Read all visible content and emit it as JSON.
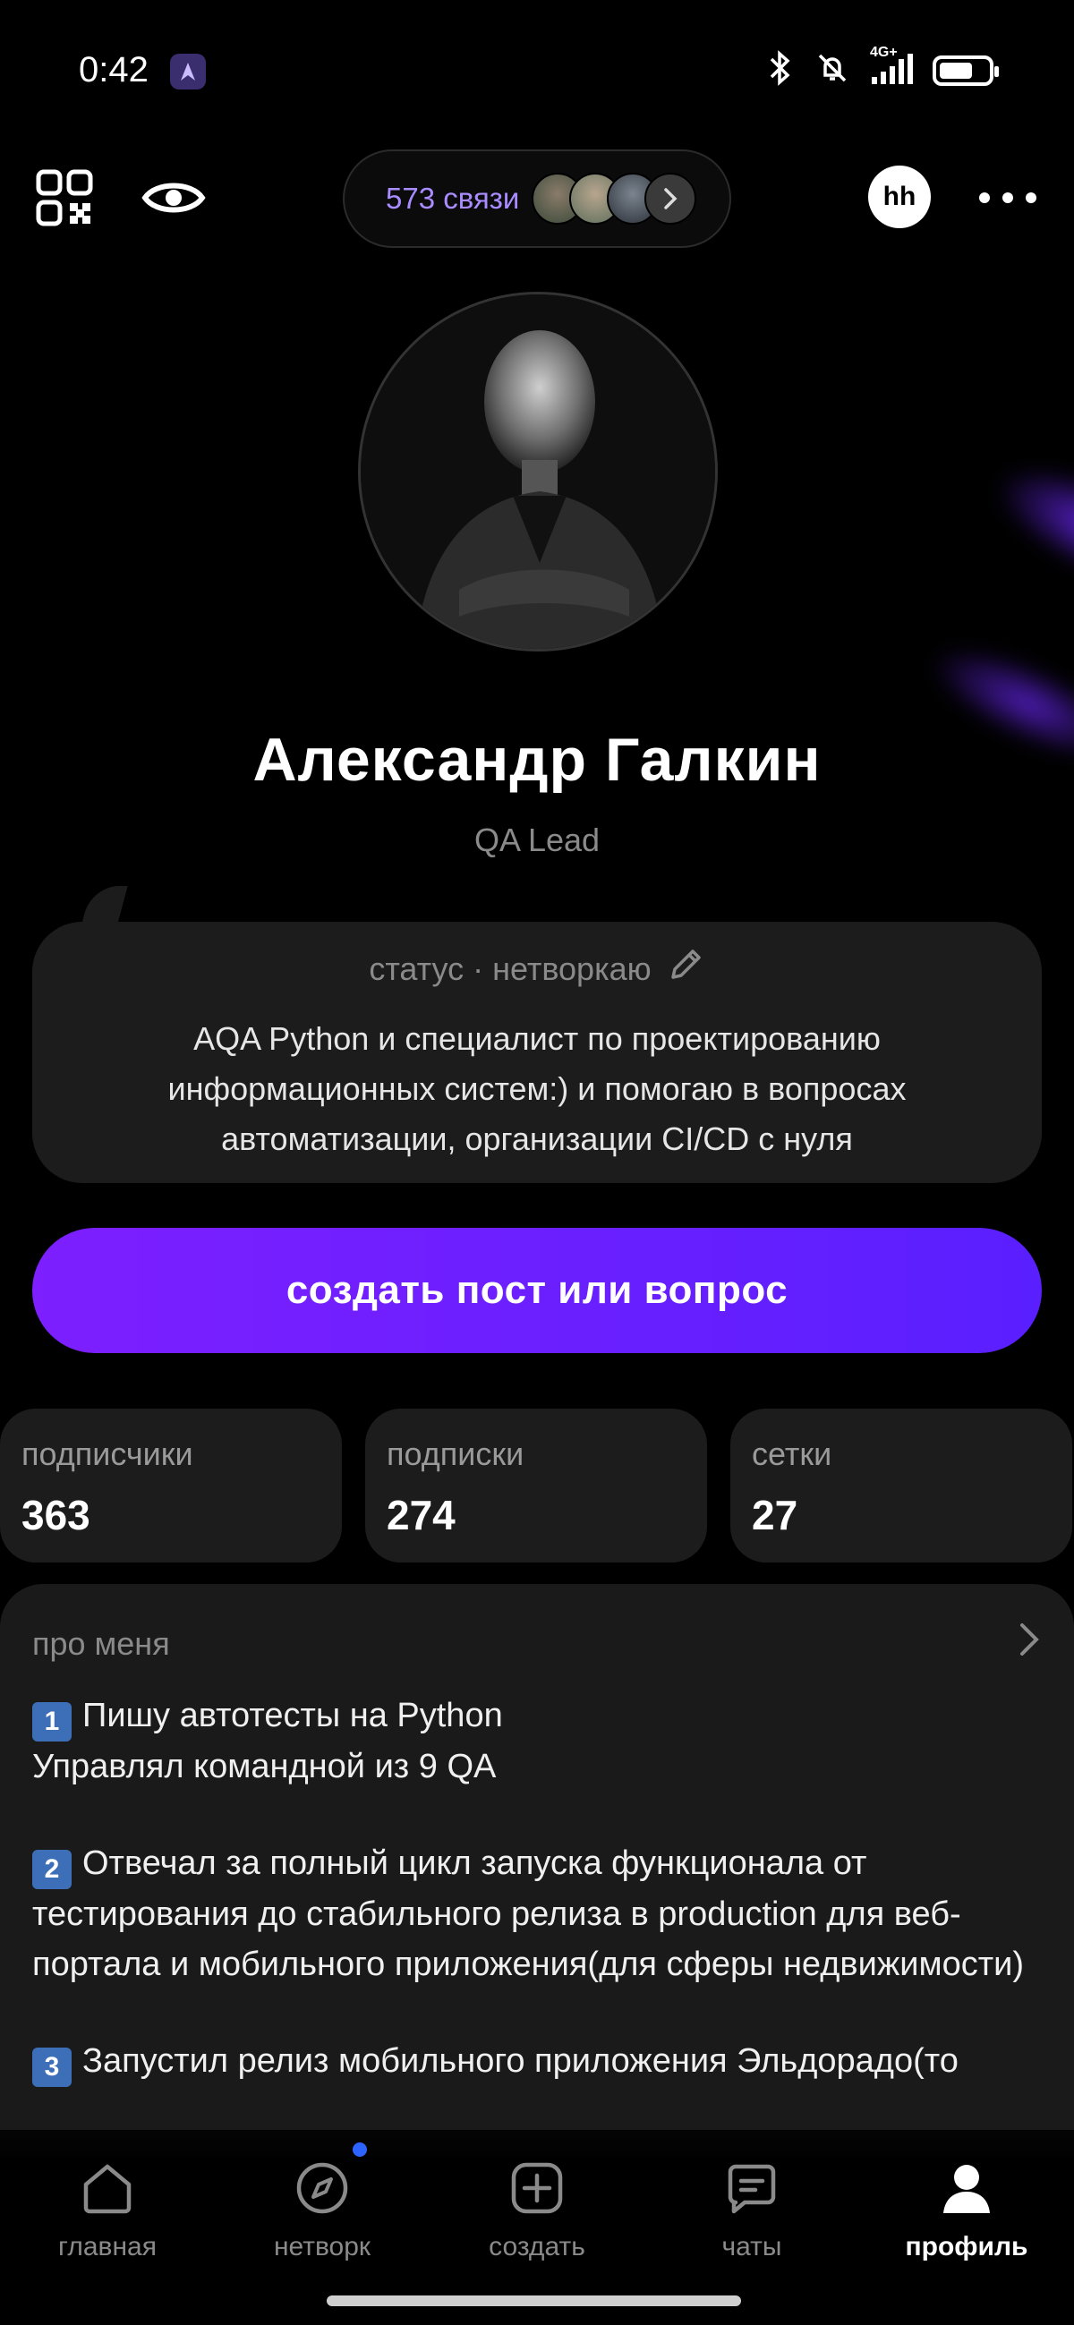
{
  "status_bar": {
    "time": "0:42",
    "network": "4G+"
  },
  "top_bar": {
    "connections_label": "573 связи",
    "hh_badge": "hh"
  },
  "profile": {
    "name": "Александр Галкин",
    "role": "QA Lead"
  },
  "status": {
    "header": "статус · нетворкаю",
    "text": "AQA Python и специалист по проектированию информационных систем:) и помогаю в вопросах автоматизации, организации CI/CD с нуля"
  },
  "cta": {
    "label": "создать пост или вопрос"
  },
  "stats": [
    {
      "label": "подписчики",
      "value": "363"
    },
    {
      "label": "подписки",
      "value": "274"
    },
    {
      "label": "сетки",
      "value": "27"
    }
  ],
  "about": {
    "title": "про меня",
    "items": [
      {
        "num": "1",
        "lines": [
          "Пишу автотесты на Python",
          "Управлял командной из 9 QA"
        ]
      },
      {
        "num": "2",
        "lines": [
          "Отвечал за полный цикл запуска функционала от тестирования до стабильного релиза в production для веб-портала и мобильного приложения(для сферы недвижимости)"
        ]
      },
      {
        "num": "3",
        "lines": [
          "Запустил релиз мобильного приложения Эльдорадо(то"
        ]
      }
    ]
  },
  "nav": [
    {
      "label": "главная",
      "icon": "home-icon"
    },
    {
      "label": "нетворк",
      "icon": "compass-icon"
    },
    {
      "label": "создать",
      "icon": "plus-square-icon"
    },
    {
      "label": "чаты",
      "icon": "chat-icon"
    },
    {
      "label": "профиль",
      "icon": "profile-icon",
      "active": true
    }
  ],
  "colors": {
    "accent": "#6b1fff",
    "connections_text": "#a98cff",
    "card_bg": "#1c1c1c",
    "notification_dot": "#2d63ff"
  }
}
